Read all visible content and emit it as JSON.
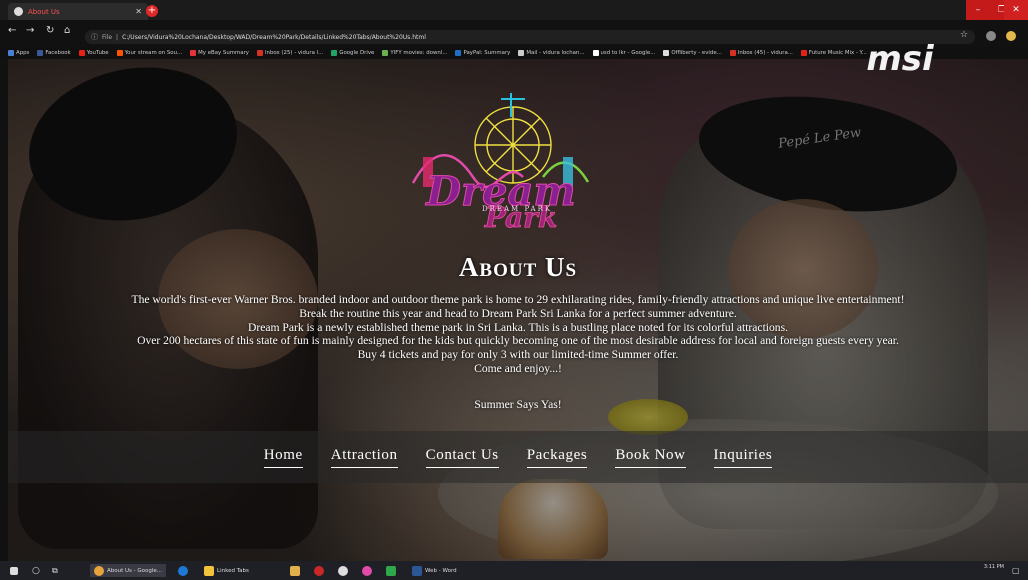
{
  "browser": {
    "tab_title": "About Us",
    "omnibox": {
      "scheme": "File",
      "url": "C:/Users/Vidura%20Lochana/Desktop/WAD/Dream%20Park/Details/Linked%20Tabs/About%20Us.html"
    },
    "bookmarks": [
      {
        "label": "Apps",
        "color": "#4a7fd6"
      },
      {
        "label": "Facebook",
        "color": "#3b5998"
      },
      {
        "label": "YouTube",
        "color": "#e62117"
      },
      {
        "label": "Your stream on Sou...",
        "color": "#ff5500"
      },
      {
        "label": "My eBay Summary",
        "color": "#e53238"
      },
      {
        "label": "Inbox (25) - vidura l...",
        "color": "#d93025"
      },
      {
        "label": "Google Drive",
        "color": "#1fa463"
      },
      {
        "label": "YIFY movies: downl...",
        "color": "#6ab04c"
      },
      {
        "label": "PayPal: Summary",
        "color": "#1f6fc5"
      },
      {
        "label": "Mail - vidura lochan...",
        "color": "#cccccc"
      },
      {
        "label": "usd to lkr - Google...",
        "color": "#ffffff"
      },
      {
        "label": "Offliberty - evide...",
        "color": "#dddddd"
      },
      {
        "label": "Inbox (45) - vidura...",
        "color": "#d93025"
      },
      {
        "label": "Future Music Mix - Y...",
        "color": "#e62117"
      }
    ]
  },
  "brand": {
    "watermark": "msi",
    "logo_sub": "DREAM PARK",
    "hat_text": "Pepé Le Pew"
  },
  "about": {
    "title": "About Us",
    "lines": [
      "The world's first-ever Warner Bros. branded indoor and outdoor theme park is home to 29 exhilarating rides, family-friendly attractions and unique live entertainment!",
      "Break the routine this year and head to Dream Park Sri Lanka for a perfect summer adventure.",
      "Dream Park is a newly established theme park in Sri Lanka. This is a bustling place noted for its colorful attractions.",
      "Over 200 hectares of this state of fun is mainly designed for the kids but quickly becoming one of the most desirable address for local and foreign guests every year.",
      "Buy 4 tickets and pay for only 3 with our limited-time Summer offer.",
      "Come and enjoy...!"
    ],
    "slogan": "Summer Says Yas!"
  },
  "nav": {
    "home": "Home",
    "attraction": "Attraction",
    "contact": "Contact Us",
    "packages": "Packages",
    "book": "Book Now",
    "inquiries": "Inquiries"
  },
  "taskbar": {
    "chrome_label": "About Us - Google...",
    "folder_label": "Linked Tabs",
    "word_label": "Web - Word",
    "time": "3:11 PM"
  }
}
